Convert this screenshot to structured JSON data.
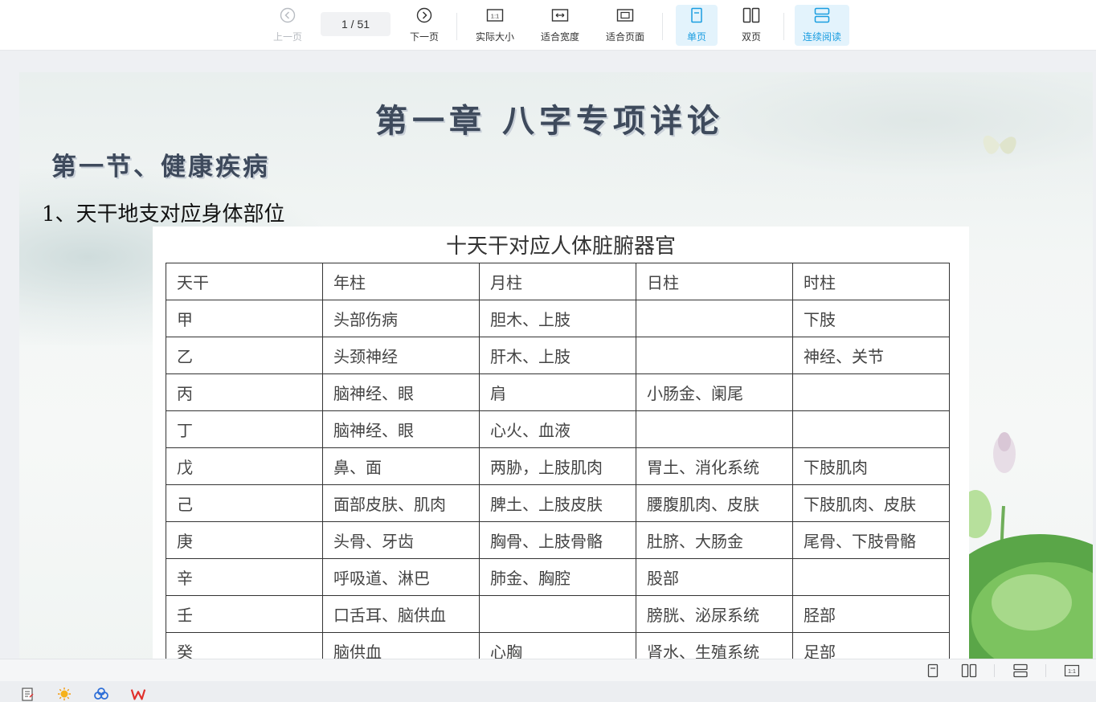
{
  "toolbar": {
    "prev": {
      "label": "上一页",
      "icon": "chevron-left-circle-icon"
    },
    "page_indicator": "1 / 51",
    "next": {
      "label": "下一页",
      "icon": "chevron-right-circle-icon"
    },
    "actual_size": {
      "label": "实际大小",
      "icon": "one-to-one-icon"
    },
    "fit_width": {
      "label": "适合宽度",
      "icon": "fit-width-icon"
    },
    "fit_page": {
      "label": "适合页面",
      "icon": "fit-page-icon"
    },
    "single_page": {
      "label": "单页",
      "icon": "single-page-icon"
    },
    "double_page": {
      "label": "双页",
      "icon": "double-page-icon"
    },
    "continuous": {
      "label": "连续阅读",
      "icon": "continuous-read-icon"
    },
    "accent_color": "#1a9de0"
  },
  "document": {
    "chapter_title": "第一章  八字专项详论",
    "section_title": "第一节、健康疾病",
    "subheading": "1、天干地支对应身体部位",
    "table_title": "十天干对应人体脏腑器官",
    "table": {
      "header": [
        "天干",
        "年柱",
        "月柱",
        "日柱",
        "时柱"
      ],
      "rows": [
        [
          "甲",
          "头部伤病",
          "胆木、上肢",
          "",
          "下肢"
        ],
        [
          "乙",
          "头颈神经",
          "肝木、上肢",
          "",
          "神经、关节"
        ],
        [
          "丙",
          "脑神经、眼",
          "肩",
          "小肠金、阑尾",
          ""
        ],
        [
          "丁",
          "脑神经、眼",
          "心火、血液",
          "",
          ""
        ],
        [
          "戊",
          "鼻、面",
          "两胁，上肢肌肉",
          "胃土、消化系统",
          "下肢肌肉"
        ],
        [
          "己",
          "面部皮肤、肌肉",
          "脾土、上肢皮肤",
          "腰腹肌肉、皮肤",
          "下肢肌肉、皮肤"
        ],
        [
          "庚",
          "头骨、牙齿",
          "胸骨、上肢骨骼",
          "肚脐、大肠金",
          "尾骨、下肢骨骼"
        ],
        [
          "辛",
          "呼吸道、淋巴",
          "肺金、胸腔",
          "股部",
          ""
        ],
        [
          "壬",
          "口舌耳、脑供血",
          "",
          "膀胱、泌尿系统",
          "胫部"
        ],
        [
          "癸",
          "脑供血",
          "心胸",
          "肾水、生殖系统",
          "足部"
        ]
      ]
    }
  },
  "statusbar": {
    "icons": [
      "single-page-icon",
      "double-page-icon",
      "continuous-read-icon",
      "actual-size-icon"
    ]
  },
  "taskbar": {
    "icons": [
      "notepad-icon",
      "sun-app-icon",
      "cloud-app-icon",
      "wps-icon"
    ]
  }
}
